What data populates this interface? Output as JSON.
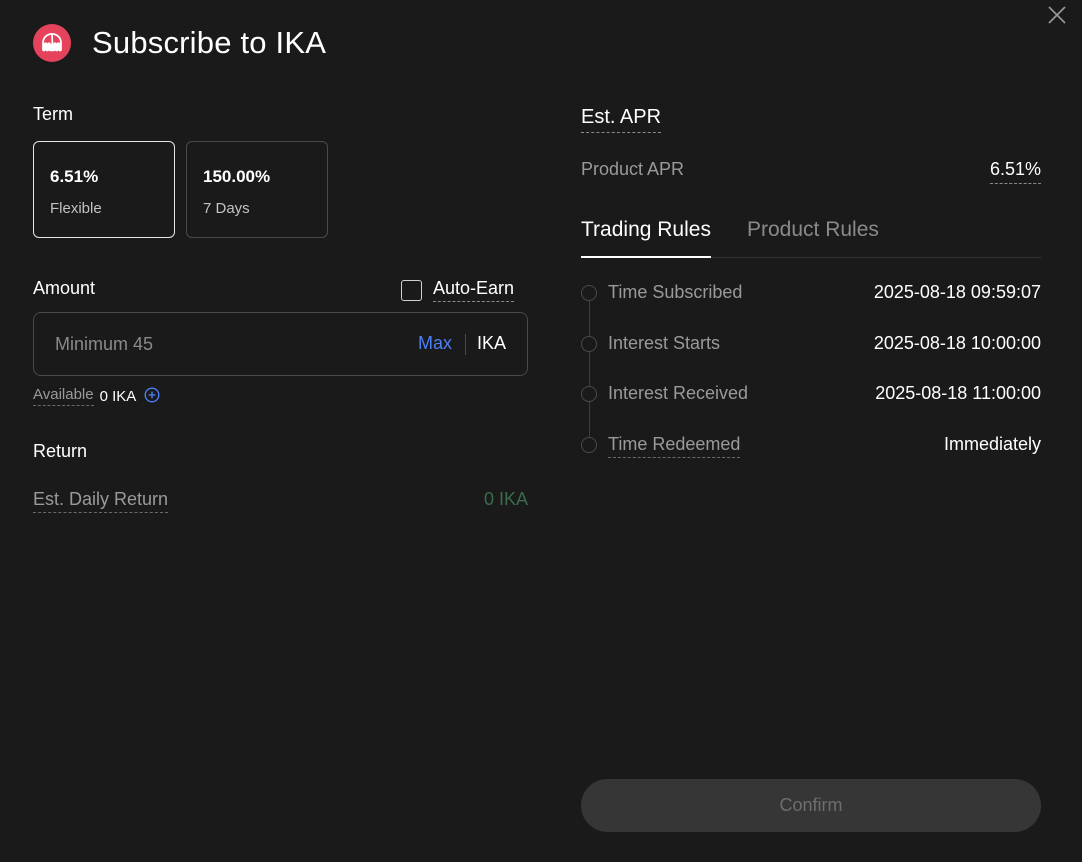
{
  "header": {
    "title": "Subscribe to IKA",
    "logo_icon": "kraken-octopus-icon",
    "logo_color": "#e4435b",
    "close_icon": "close-icon"
  },
  "term": {
    "label": "Term",
    "options": [
      {
        "rate": "6.51%",
        "duration": "Flexible",
        "selected": true
      },
      {
        "rate": "150.00%",
        "duration": "7 Days",
        "selected": false
      }
    ]
  },
  "amount": {
    "label": "Amount",
    "auto_earn_label": "Auto-Earn",
    "auto_earn_checked": false,
    "placeholder": "Minimum 45",
    "value": "",
    "max_label": "Max",
    "unit": "IKA",
    "available_label": "Available",
    "available_value": "0 IKA"
  },
  "return": {
    "label": "Return",
    "daily_return_label": "Est. Daily Return",
    "daily_return_value": "0 IKA"
  },
  "apr": {
    "title": "Est. APR",
    "product_apr_label": "Product APR",
    "product_apr_value": "6.51%"
  },
  "tabs": [
    {
      "label": "Trading Rules",
      "active": true
    },
    {
      "label": "Product Rules",
      "active": false
    }
  ],
  "timeline": [
    {
      "label": "Time Subscribed",
      "value": "2025-08-18 09:59:07"
    },
    {
      "label": "Interest Starts",
      "value": "2025-08-18 10:00:00"
    },
    {
      "label": "Interest Received",
      "value": "2025-08-18 11:00:00"
    },
    {
      "label": "Time Redeemed",
      "value": "Immediately"
    }
  ],
  "confirm_label": "Confirm",
  "colors": {
    "background": "#1a1a1a",
    "accent_link": "#4b7ff5",
    "return_value": "#3b6b4d",
    "button_disabled_bg": "#363636"
  }
}
